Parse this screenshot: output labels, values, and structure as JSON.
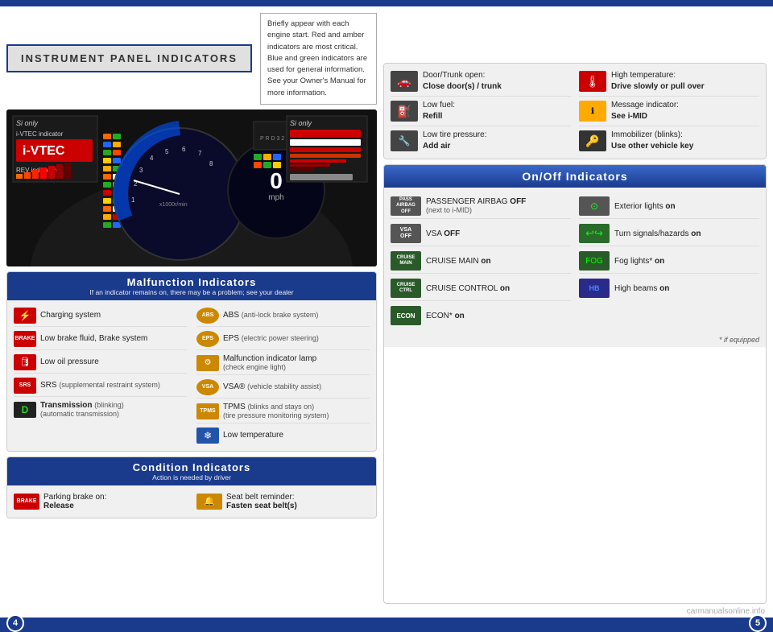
{
  "page": {
    "title": "INSTRUMENT PANEL INDICATORS",
    "subtitle_note": "Briefly appear with each engine start. Red and amber indicators are most critical. Blue and green indicators are used for general information. See your Owner's Manual for more information.",
    "page_left": "4",
    "page_right": "5",
    "watermark": "carmanualsonline.info"
  },
  "dashboard": {
    "mph_value": "0",
    "mph_label": "mph",
    "tach_label": "x1000r/min",
    "si_label": "Si only",
    "si_label2": "Si only",
    "vtec_label": "i-VTEC indicator",
    "rev_label": "REV indicators"
  },
  "malfunction_section": {
    "title": "Malfunction Indicators",
    "subtitle": "If an indicator remains on, there may be a problem; see your dealer",
    "indicators": [
      {
        "icon_type": "red",
        "icon_text": "⚡",
        "label": "Charging system"
      },
      {
        "icon_type": "amber",
        "icon_text": "ABS",
        "label": "ABS",
        "sublabel": "(anti-lock brake system)"
      },
      {
        "icon_type": "red-brake",
        "icon_text": "BRAKE",
        "label": "Low brake fluid, Brake system"
      },
      {
        "icon_type": "amber",
        "icon_text": "EPS",
        "label": "EPS",
        "sublabel": "(electric power steering)"
      },
      {
        "icon_type": "red",
        "icon_text": "🛢",
        "label": "Low oil pressure"
      },
      {
        "icon_type": "amber",
        "icon_text": "⚙",
        "label": "Malfunction indicator lamp",
        "sublabel": "(check engine light)"
      },
      {
        "icon_type": "red",
        "icon_text": "SRS",
        "label": "SRS",
        "sublabel": "(supplemental restraint system)"
      },
      {
        "icon_type": "amber",
        "icon_text": "VSA",
        "label": "VSA®",
        "sublabel": "(vehicle stability assist)"
      },
      {
        "icon_type": "black-d",
        "icon_text": "D",
        "label": "Transmission",
        "sublabel": "(blinking) (automatic transmission)"
      },
      {
        "icon_type": "amber",
        "icon_text": "TPMS",
        "label": "TPMS",
        "sublabel": "(blinks and stays on) (tire pressure monitoring system)"
      },
      {
        "icon_type": "amber",
        "icon_text": "❄",
        "label": "Low temperature"
      }
    ]
  },
  "condition_section": {
    "title": "Condition Indicators",
    "subtitle": "Action is needed by driver",
    "indicators": [
      {
        "icon_type": "red-brake",
        "icon_text": "BRAKE",
        "label": "Parking brake on:",
        "label2": "Release"
      },
      {
        "icon_type": "amber",
        "icon_text": "🔔",
        "label": "Seat belt reminder:",
        "label2": "Fasten seat belt(s)"
      }
    ]
  },
  "info_section": {
    "indicators": [
      {
        "icon_bg": "#444",
        "icon_text": "🚗",
        "label": "Door/Trunk open:",
        "label2": "Close door(s) / trunk"
      },
      {
        "icon_bg": "#cc0000",
        "icon_text": "🌡",
        "label": "High temperature:",
        "label2": "Drive slowly or pull over"
      },
      {
        "icon_bg": "#444",
        "icon_text": "⛽",
        "label": "Low fuel:",
        "label2": "Refill"
      },
      {
        "icon_bg": "#ffaa00",
        "icon_text": "ℹ",
        "label": "Message indicator:",
        "label2": "See i-MID"
      },
      {
        "icon_bg": "#444",
        "icon_text": "🔧",
        "label": "Low tire pressure:",
        "label2": "Add air"
      },
      {
        "icon_bg": "#333",
        "icon_text": "🔑",
        "label": "Immobilizer (blinks):",
        "label2": "Use other vehicle key"
      }
    ]
  },
  "onoff_section": {
    "title": "On/Off Indicators",
    "indicators_left": [
      {
        "icon_bg": "#555",
        "icon_text": "PASS\nAIRBAG\nOFF",
        "label": "PASSENGER AIRBAG ",
        "on_label": "OFF",
        "sublabel": "(next to i-MID)"
      },
      {
        "icon_bg": "#555",
        "icon_text": "VSA\nOFF",
        "label": "VSA ",
        "on_label": "OFF",
        "sublabel": ""
      },
      {
        "icon_bg": "#2a5a2a",
        "icon_text": "CRUISE\nMAIN",
        "label": "CRUISE MAIN ",
        "on_label": "on",
        "sublabel": ""
      },
      {
        "icon_bg": "#2a5a2a",
        "icon_text": "CRUISE\nCTRL",
        "label": "CRUISE CONTROL ",
        "on_label": "on",
        "sublabel": ""
      },
      {
        "icon_bg": "#2a5a2a",
        "icon_text": "ECON",
        "label": "ECON* ",
        "on_label": "on",
        "sublabel": ""
      }
    ],
    "indicators_right": [
      {
        "icon_bg": "#555",
        "icon_text": "EXTR\nLGHT",
        "label": "Exterior lights ",
        "on_label": "on",
        "sublabel": ""
      },
      {
        "icon_bg": "#2a8a2a",
        "icon_text": "↩↪",
        "label": "Turn signals/hazards ",
        "on_label": "on",
        "sublabel": ""
      },
      {
        "icon_bg": "#2a5a2a",
        "icon_text": "FOG",
        "label": "Fog lights* ",
        "on_label": "on",
        "sublabel": ""
      },
      {
        "icon_bg": "#2a2a8a",
        "icon_text": "HB",
        "label": "High beams ",
        "on_label": "on",
        "sublabel": ""
      }
    ],
    "footnote": "* if equipped"
  }
}
